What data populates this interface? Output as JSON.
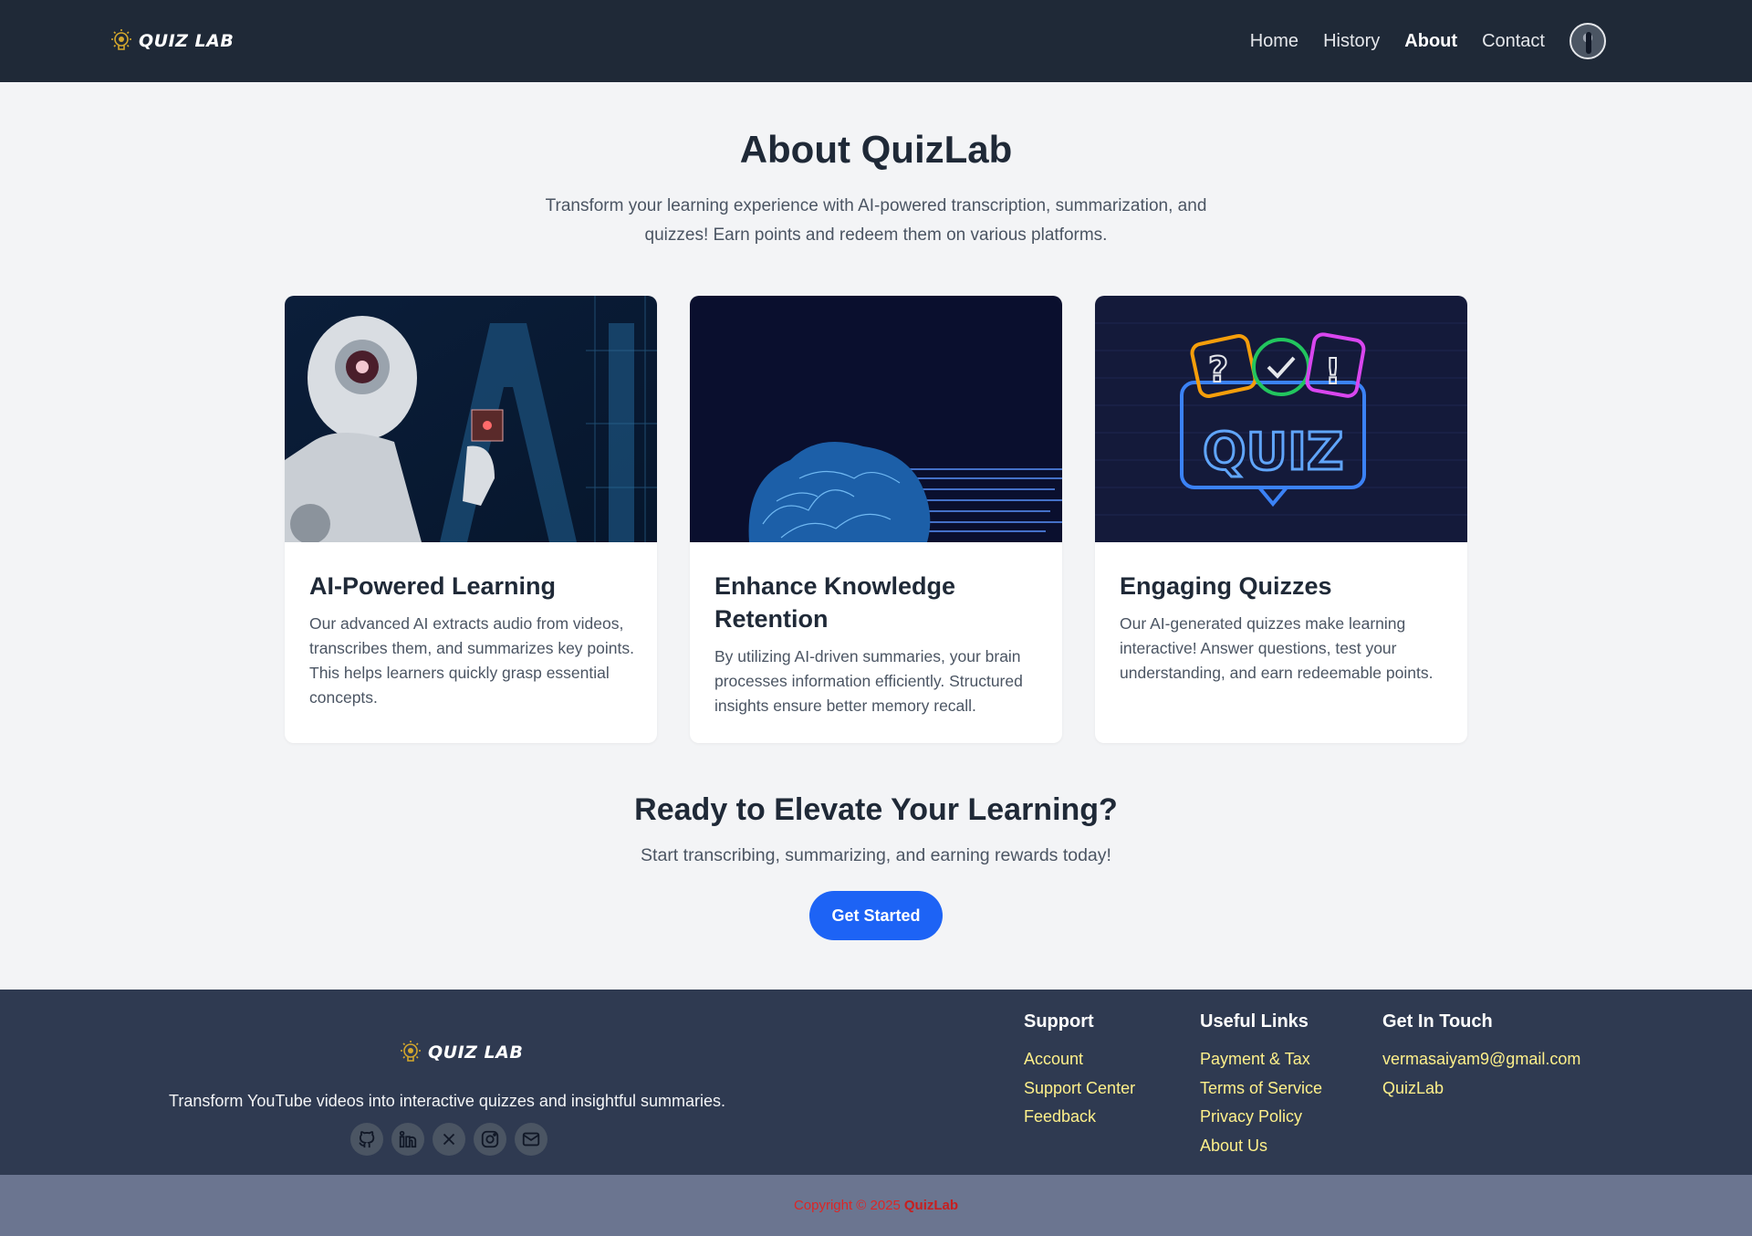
{
  "nav": {
    "logo_text": "QUIZ LAB",
    "links": [
      "Home",
      "History",
      "About",
      "Contact"
    ],
    "active": "About"
  },
  "hero": {
    "title": "About QuizLab",
    "subtitle": "Transform your learning experience with AI-powered transcription, summarization, and quizzes! Earn points and redeem them on various platforms."
  },
  "cards": [
    {
      "title": "AI-Powered Learning",
      "text": "Our advanced AI extracts audio from videos, transcribes them, and summarizes key points. This helps learners quickly grasp essential concepts."
    },
    {
      "title": "Enhance Knowledge Retention",
      "text": "By utilizing AI-driven summaries, your brain processes information efficiently. Structured insights ensure better memory recall."
    },
    {
      "title": "Engaging Quizzes",
      "text": "Our AI-generated quizzes make learning interactive! Answer questions, test your understanding, and earn redeemable points."
    }
  ],
  "cta": {
    "title": "Ready to Elevate Your Learning?",
    "subtitle": "Start transcribing, summarizing, and earning rewards today!",
    "button": "Get Started"
  },
  "footer": {
    "logo_text": "QUIZ LAB",
    "tagline": "Transform YouTube videos into interactive quizzes and insightful summaries.",
    "socials": [
      "github-icon",
      "linkedin-icon",
      "x-icon",
      "instagram-icon",
      "mail-icon"
    ],
    "support": {
      "heading": "Support",
      "links": [
        "Account",
        "Support Center",
        "Feedback"
      ]
    },
    "useful_links": {
      "heading": "Useful Links",
      "links": [
        "Payment & Tax",
        "Terms of Service",
        "Privacy Policy",
        "About Us"
      ]
    },
    "get_in_touch": {
      "heading": "Get In Touch",
      "links": [
        "vermasaiyam9@gmail.com",
        "QuizLab"
      ]
    },
    "copyright": "Copyright © 2025",
    "copyright_brand": "QuizLab"
  },
  "colors": {
    "nav_bg": "#1f2937",
    "footer_bg": "#2f3a51",
    "accent": "#1d63f5",
    "footer_link": "#fef08a",
    "copyright": "#dc2626"
  }
}
